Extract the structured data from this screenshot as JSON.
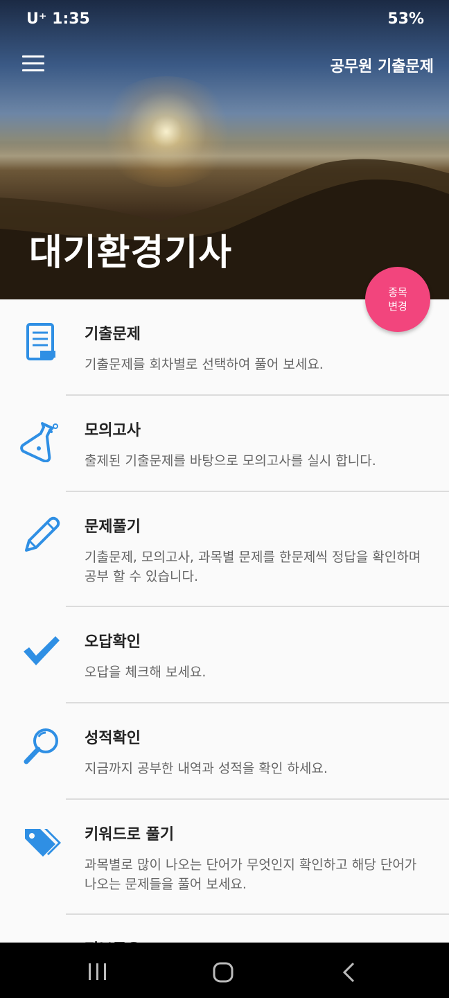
{
  "status_bar": {
    "time": "U⁺ 1:35",
    "battery": "53%"
  },
  "header": {
    "top_link": "공무원 기출문제",
    "title": "대기환경기사"
  },
  "fab": {
    "line1": "종목",
    "line2": "변경"
  },
  "menu_items": [
    {
      "title": "기출문제",
      "desc": "기출문제를 회차별로 선택하여 풀어 보세요.",
      "icon": "notepad-icon"
    },
    {
      "title": "모의고사",
      "desc": "출제된 기출문제를 바탕으로 모의고사를 실시 합니다.",
      "icon": "flask-icon"
    },
    {
      "title": "문제풀기",
      "desc": "기출문제, 모의고사, 과목별 문제를 한문제씩 정답을 확인하며 공부 할 수 있습니다.",
      "icon": "pencil-icon"
    },
    {
      "title": "오답확인",
      "desc": "오답을 체크해 보세요.",
      "icon": "checkmark-icon"
    },
    {
      "title": "성적확인",
      "desc": "지금까지 공부한 내역과 성적을 확인 하세요.",
      "icon": "magnifier-icon"
    },
    {
      "title": "키워드로 풀기",
      "desc": "과목별로 많이 나오는 단어가 무엇인지 확인하고 해당 단어가 나오는 문제들을 풀어 보세요.",
      "icon": "tags-icon"
    },
    {
      "title": "정보공유",
      "desc": "",
      "icon": "info-icon"
    }
  ],
  "colors": {
    "accent": "#2f8fe4",
    "fab": "#f2457d"
  }
}
